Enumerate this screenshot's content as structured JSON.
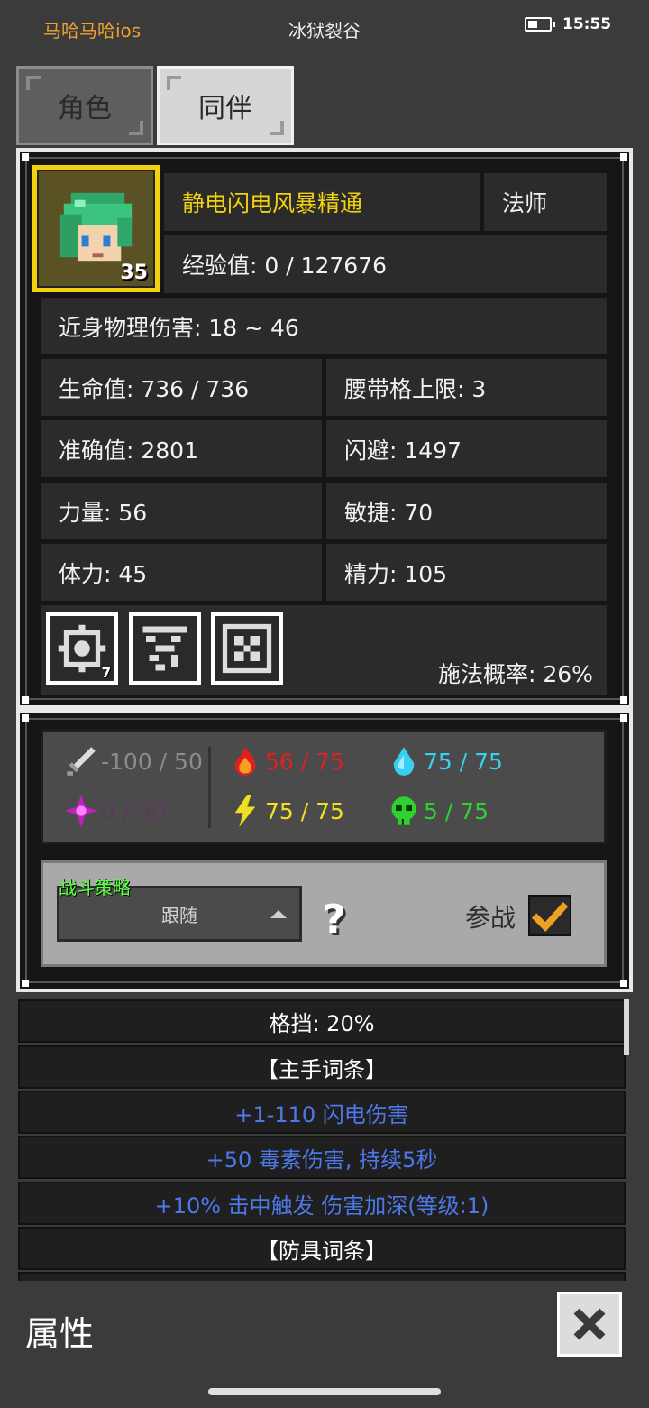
{
  "status_bar": {
    "app_label": "马哈马哈ios",
    "title": "冰狱裂谷",
    "time": "15:55"
  },
  "tabs": [
    {
      "label": "角色",
      "active": false
    },
    {
      "label": "同伴",
      "active": true
    }
  ],
  "character": {
    "name": "静电闪电风暴精通",
    "class": "法师",
    "level": "35",
    "experience": "经验值: 0 / 127676",
    "melee_damage": "近身物理伤害: 18 ~ 46",
    "stats": [
      [
        "生命值: 736 / 736",
        "腰带格上限: 3"
      ],
      [
        "准确值: 2801",
        "闪避: 1497"
      ],
      [
        "力量: 56",
        "敏捷: 70"
      ],
      [
        "体力: 45",
        "精力: 105"
      ]
    ],
    "skills": [
      {
        "icon": "gear-skill-icon",
        "count": "7"
      },
      {
        "icon": "lightning-glyph-skill-icon"
      },
      {
        "icon": "pattern-skill-icon"
      }
    ],
    "cast_chance": "施法概率: 26%"
  },
  "resistances": {
    "physical": {
      "icon": "sword-icon",
      "value": "-100 / 50",
      "color": "#8c8c8c"
    },
    "fire": {
      "icon": "fire-icon",
      "value": "56 / 75",
      "color": "#e02020"
    },
    "cold": {
      "icon": "water-drop-icon",
      "value": "75 / 75",
      "color": "#36d0f0"
    },
    "arcane": {
      "icon": "arcane-star-icon",
      "value": "0 / 50",
      "color": "#5b3a5b"
    },
    "lightning": {
      "icon": "lightning-icon",
      "value": "75 / 75",
      "color": "#f0e020"
    },
    "poison": {
      "icon": "skull-icon",
      "value": "5 / 75",
      "color": "#30d030"
    }
  },
  "strategy": {
    "label": "战斗策略",
    "selected": "跟随",
    "join_label": "参战",
    "join_checked": true
  },
  "list": [
    {
      "text": "格挡: 20%",
      "kind": "hdr"
    },
    {
      "text": "【主手词条】",
      "kind": "hdr"
    },
    {
      "text": "+1-110 闪电伤害",
      "kind": "aff"
    },
    {
      "text": "+50 毒素伤害, 持续5秒",
      "kind": "aff"
    },
    {
      "text": "+10% 击中触发 伤害加深(等级:1)",
      "kind": "aff"
    },
    {
      "text": "【防具词条】",
      "kind": "hdr"
    }
  ],
  "footer": {
    "title": "属性"
  }
}
